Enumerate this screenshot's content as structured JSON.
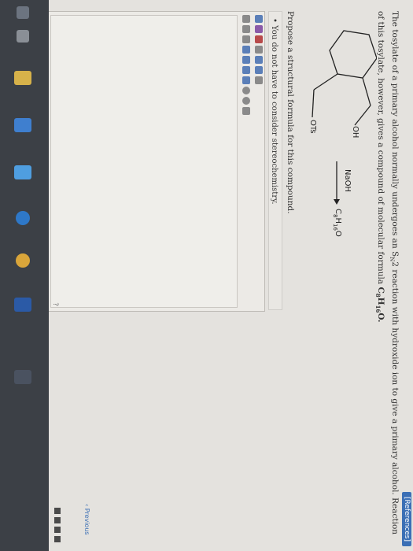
{
  "header": {
    "references_label": "[References]"
  },
  "question": {
    "text_part1": "The tosylate of a primary alcohol normally undergoes an S",
    "text_sn2_sub": "N",
    "text_part2": "2 reaction with hydroxide ion to give a primary alcohol. Reaction of this tosylate, however, gives a compound of molecular formula ",
    "formula_main": "C",
    "formula_sub1": "8",
    "formula_h": "H",
    "formula_sub2": "16",
    "formula_end": "O."
  },
  "reaction": {
    "oh_label": "OH",
    "ots_label": "OTs",
    "reagent": "NaOH",
    "product_main": "C",
    "product_sub1": "8",
    "product_h": "H",
    "product_sub2": "16",
    "product_end": "O"
  },
  "prompt": {
    "text": "Propose a structural formula for this compound."
  },
  "note": {
    "text": "You do not have to consider stereochemistry."
  },
  "editor": {
    "help_label": "?",
    "colors": {
      "tool_blue": "#5b7fb8",
      "tool_purple": "#8a5aa8",
      "tool_red": "#b84a4a",
      "tool_gray": "#8a8a8a"
    }
  },
  "navigation": {
    "previous_label": "Previous"
  },
  "taskbar": {
    "icons": [
      "back-icon",
      "task-view-icon",
      "file-explorer-icon",
      "store-icon",
      "mail-icon",
      "edge-icon",
      "chrome-icon",
      "word-icon",
      "search-icon"
    ]
  }
}
